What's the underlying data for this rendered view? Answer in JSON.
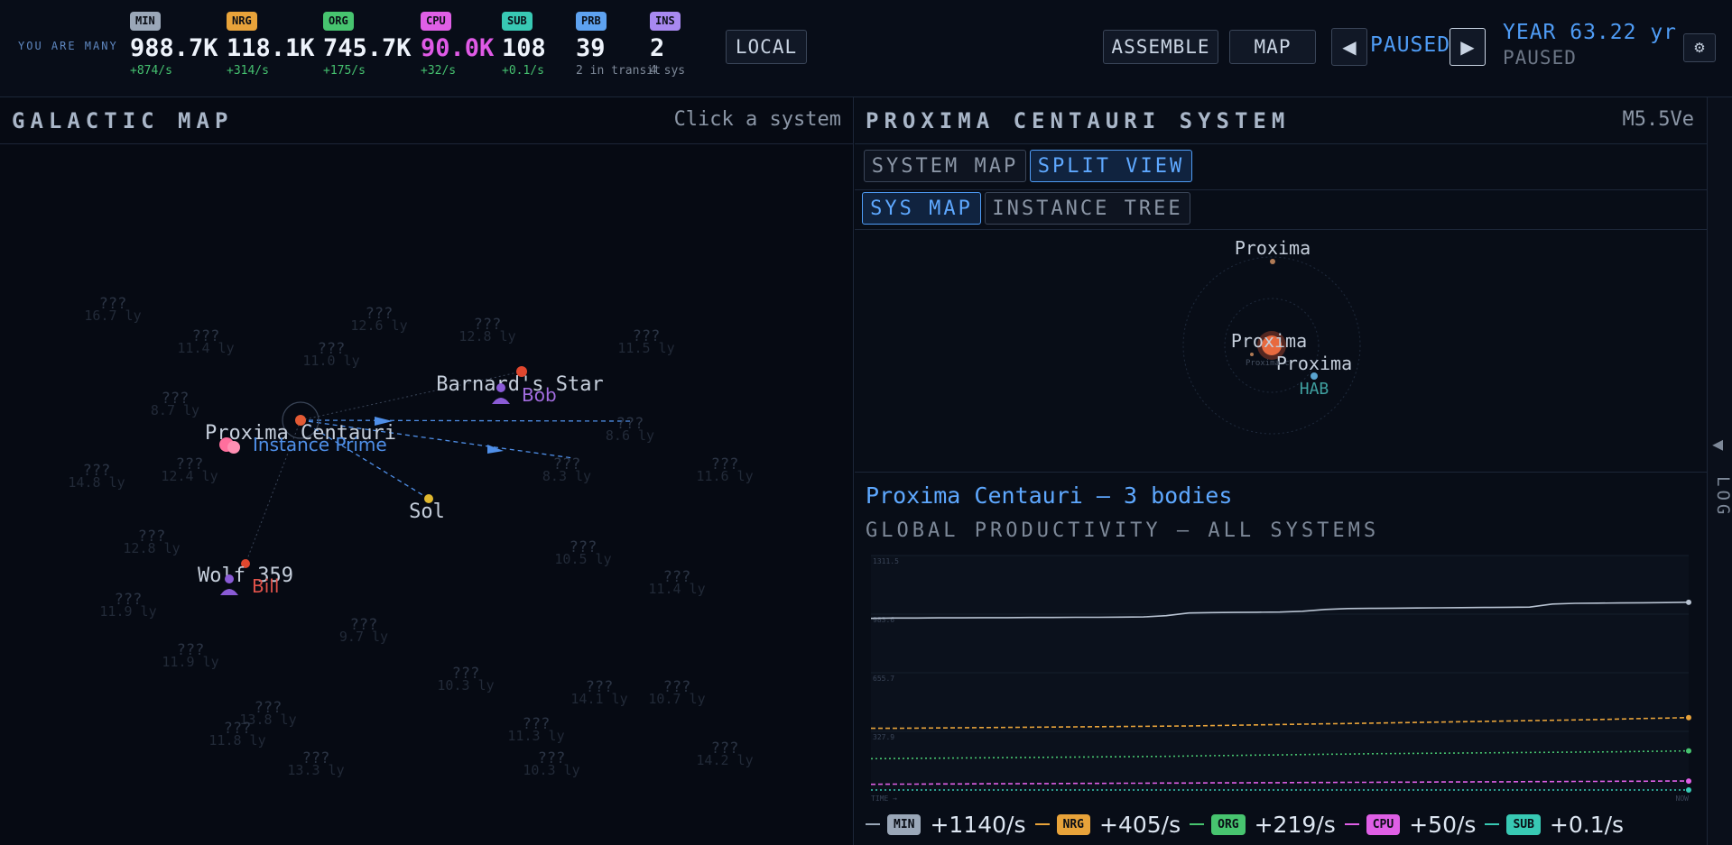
{
  "header": {
    "brand": "YOU ARE MANY",
    "resources": [
      {
        "key": "MIN",
        "value": "988.7K",
        "rate": "+874/s",
        "color": "#9aa7b8"
      },
      {
        "key": "NRG",
        "value": "118.1K",
        "rate": "+314/s",
        "color": "#e8a33a"
      },
      {
        "key": "ORG",
        "value": "745.7K",
        "rate": "+175/s",
        "color": "#47c46f"
      },
      {
        "key": "CPU",
        "value": "90.0K",
        "rate": "+32/s",
        "color": "#df5fe6"
      },
      {
        "key": "SUB",
        "value": "108",
        "rate": "+0.1/s",
        "color": "#38c9b4"
      },
      {
        "key": "PRB",
        "value": "39",
        "rate": "2 in transit",
        "color": "#5ea2f0"
      },
      {
        "key": "INS",
        "value": "2",
        "rate": "4 sys",
        "color": "#a889f0"
      }
    ],
    "local_label": "LOCAL",
    "assemble_label": "ASSEMBLE",
    "map_label": "MAP",
    "prev_icon": "◀",
    "next_icon": "▶",
    "status": "PAUSED",
    "year": "YEAR 63.22 yr",
    "year_status": "PAUSED",
    "settings_icon": "⚙"
  },
  "galactic_map": {
    "title": "GALACTIC MAP",
    "hint": "Click a system",
    "systems": [
      {
        "name": "Barnard's Star",
        "occupant": "Bob",
        "occupant_color": "#a36de0"
      },
      {
        "name": "Proxima Centauri",
        "occupant": "Instance Prime",
        "occupant_color": "#4f8fe8"
      },
      {
        "name": "Sol",
        "occupant": "",
        "occupant_color": ""
      },
      {
        "name": "Wolf 359",
        "occupant": "Bill",
        "occupant_color": "#e0524a"
      }
    ],
    "unknown_systems": [
      {
        "label": "???",
        "dist": "16.7 ly"
      },
      {
        "label": "???",
        "dist": "12.6 ly"
      },
      {
        "label": "???",
        "dist": "12.8 ly"
      },
      {
        "label": "???",
        "dist": "11.4 ly"
      },
      {
        "label": "???",
        "dist": "11.0 ly"
      },
      {
        "label": "???",
        "dist": "11.5 ly"
      },
      {
        "label": "???",
        "dist": "8.7 ly"
      },
      {
        "label": "???",
        "dist": "8.6 ly"
      },
      {
        "label": "???",
        "dist": "14.8 ly"
      },
      {
        "label": "???",
        "dist": "12.4 ly"
      },
      {
        "label": "???",
        "dist": "8.3 ly"
      },
      {
        "label": "???",
        "dist": "11.6 ly"
      },
      {
        "label": "???",
        "dist": "12.8 ly"
      },
      {
        "label": "???",
        "dist": "10.5 ly"
      },
      {
        "label": "???",
        "dist": "11.9 ly"
      },
      {
        "label": "???",
        "dist": "11.4 ly"
      },
      {
        "label": "???",
        "dist": "9.7 ly"
      },
      {
        "label": "???",
        "dist": "11.9 ly"
      },
      {
        "label": "???",
        "dist": "10.3 ly"
      },
      {
        "label": "???",
        "dist": "14.1 ly"
      },
      {
        "label": "???",
        "dist": "10.7 ly"
      },
      {
        "label": "???",
        "dist": "13.8 ly"
      },
      {
        "label": "???",
        "dist": "11.8 ly"
      },
      {
        "label": "???",
        "dist": "11.3 ly"
      },
      {
        "label": "???",
        "dist": "13.3 ly"
      },
      {
        "label": "???",
        "dist": "10.3 ly"
      },
      {
        "label": "???",
        "dist": "14.2 ly"
      }
    ]
  },
  "system_panel": {
    "title": "PROXIMA CENTAURI SYSTEM",
    "spectral": "M5.5Ve",
    "view_tabs": [
      {
        "label": "SYSTEM MAP",
        "active": false
      },
      {
        "label": "SPLIT VIEW",
        "active": true
      }
    ],
    "sub_tabs": [
      {
        "label": "SYS MAP",
        "active": true
      },
      {
        "label": "INSTANCE TREE",
        "active": false
      }
    ],
    "bodies": [
      {
        "label": "Proxima"
      },
      {
        "label": "Proxima"
      },
      {
        "label": "Proxima"
      }
    ],
    "small_label": "Proxima c",
    "hab_label": "HAB",
    "bodies_title": "Proxima Centauri — 3 bodies"
  },
  "productivity": {
    "title": "GLOBAL PRODUCTIVITY — ALL SYSTEMS",
    "legend": [
      {
        "key": "MIN",
        "value": "+1140/s",
        "color": "#9aa7b8"
      },
      {
        "key": "NRG",
        "value": "+405/s",
        "color": "#e8a33a"
      },
      {
        "key": "ORG",
        "value": "+219/s",
        "color": "#47c46f"
      },
      {
        "key": "CPU",
        "value": "+50/s",
        "color": "#df5fe6"
      },
      {
        "key": "SUB",
        "value": "+0.1/s",
        "color": "#38c9b4"
      }
    ]
  },
  "chart_data": {
    "type": "line",
    "title": "GLOBAL PRODUCTIVITY — ALL SYSTEMS",
    "xlabel": "TIME →",
    "x_end_label": "NOW",
    "y_ticks": [
      "1311.5",
      "983.6",
      "655.7",
      "327.9"
    ],
    "ylim": [
      0,
      1311.5
    ],
    "grid": true,
    "series": [
      {
        "name": "MIN",
        "color": "#b8c3d2",
        "style": "solid",
        "values": [
          960,
          962,
          962,
          963,
          963,
          964,
          964,
          965,
          965,
          966,
          966,
          967,
          968,
          975,
          990,
          992,
          993,
          994,
          995,
          1000,
          1010,
          1015,
          1016,
          1017,
          1018,
          1019,
          1020,
          1021,
          1022,
          1023,
          1040,
          1044,
          1045,
          1046,
          1047,
          1048,
          1050
        ]
      },
      {
        "name": "NRG",
        "color": "#e8a33a",
        "style": "dashed",
        "values": [
          345,
          345,
          346,
          347,
          348,
          349,
          350,
          351,
          352,
          353,
          354,
          355,
          356,
          357,
          358,
          360,
          362,
          364,
          366,
          368,
          370,
          372,
          374,
          376,
          378,
          380,
          382,
          384,
          386,
          388,
          390,
          392,
          394,
          397,
          400,
          402,
          405
        ]
      },
      {
        "name": "ORG",
        "color": "#47c46f",
        "style": "dotted",
        "values": [
          175,
          176,
          177,
          178,
          179,
          180,
          181,
          182,
          183,
          184,
          185,
          186,
          187,
          188,
          190,
          192,
          193,
          195,
          196,
          198,
          200,
          201,
          203,
          204,
          205,
          206,
          207,
          208,
          209,
          210,
          211,
          212,
          213,
          214,
          216,
          217,
          219
        ]
      },
      {
        "name": "CPU",
        "color": "#df5fe6",
        "style": "dashed",
        "values": [
          32,
          33,
          33,
          34,
          34,
          35,
          35,
          36,
          36,
          37,
          37,
          38,
          38,
          39,
          39,
          40,
          40,
          41,
          41,
          42,
          42,
          43,
          43,
          44,
          44,
          45,
          45,
          46,
          46,
          47,
          47,
          48,
          48,
          49,
          49,
          50,
          50
        ]
      },
      {
        "name": "SUB",
        "color": "#38c9b4",
        "style": "dotted",
        "values": [
          0.1,
          0.1,
          0.1,
          0.1,
          0.1,
          0.1,
          0.1,
          0.1,
          0.1,
          0.1,
          0.1,
          0.1,
          0.1,
          0.1,
          0.1,
          0.1,
          0.1,
          0.1,
          0.1,
          0.1,
          0.1,
          0.1,
          0.1,
          0.1,
          0.1,
          0.1,
          0.1,
          0.1,
          0.1,
          0.1,
          0.1,
          0.1,
          0.1,
          0.1,
          0.1,
          0.1,
          0.1
        ]
      }
    ]
  },
  "log_tab": {
    "arrow": "◀",
    "label": "LOG"
  }
}
